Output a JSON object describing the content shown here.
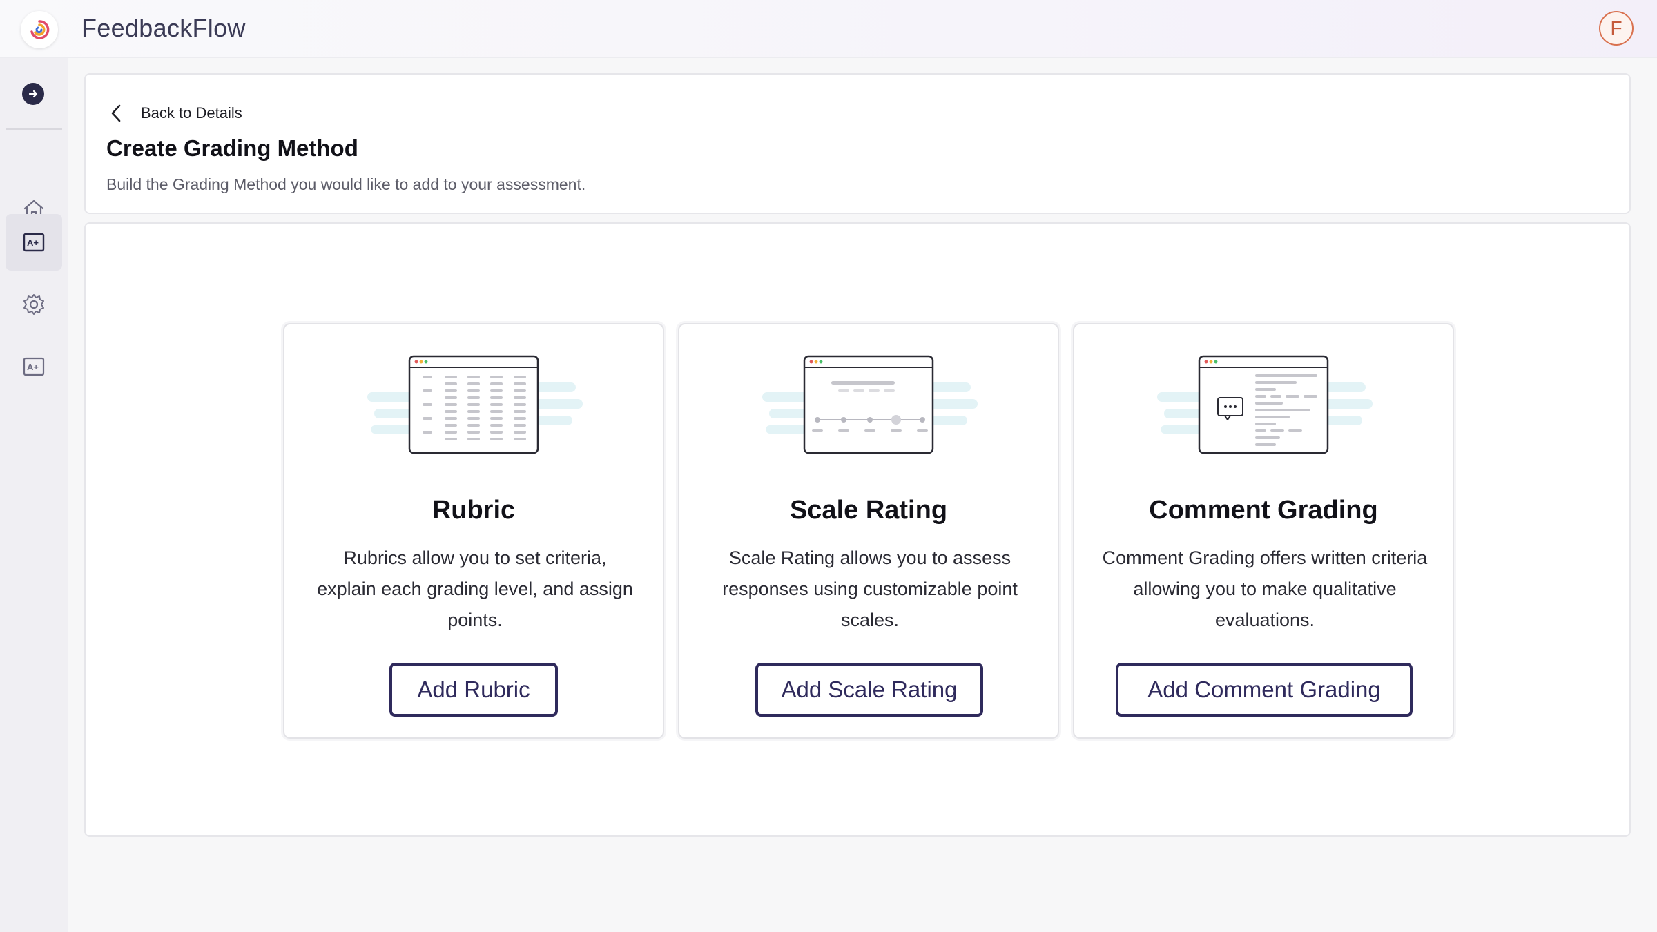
{
  "app": {
    "name": "FeedbackFlow",
    "user_initial": "F"
  },
  "header": {
    "back_label": "Back to Details",
    "title": "Create Grading Method",
    "subtitle": "Build the Grading Method you would like to add to your assessment."
  },
  "sidebar": {
    "items": [
      {
        "icon": "home-icon",
        "active": false
      },
      {
        "icon": "grade-icon",
        "active": true
      },
      {
        "icon": "gear-icon",
        "active": false
      },
      {
        "icon": "grade-icon",
        "active": false
      }
    ]
  },
  "options": [
    {
      "title": "Rubric",
      "description": "Rubrics allow you to set criteria, explain each grading level, and assign points.",
      "button": "Add Rubric",
      "illustration": "rubric-table-illustration"
    },
    {
      "title": "Scale Rating",
      "description": "Scale Rating allows you to assess responses using customizable point scales.",
      "button": "Add Scale Rating",
      "illustration": "scale-slider-illustration"
    },
    {
      "title": "Comment Grading",
      "description": "Comment Grading offers written criteria allowing you to make qualitative evaluations.",
      "button": "Add Comment Grading",
      "illustration": "comment-list-illustration"
    }
  ],
  "colors": {
    "primary": "#2f2a5c",
    "accent_bg": "#e4e3ea",
    "illustration_glow": "#e3f3f6"
  }
}
